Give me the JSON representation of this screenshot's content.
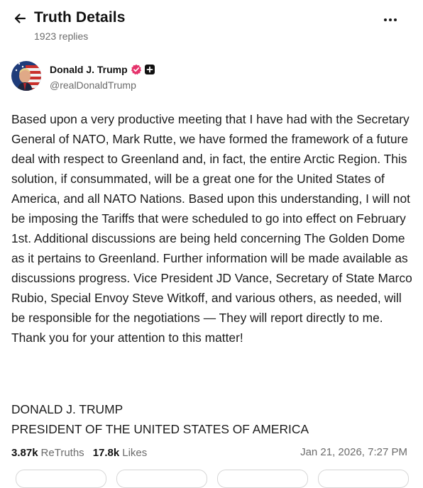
{
  "header": {
    "title": "Truth Details",
    "replies": "1923 replies"
  },
  "author": {
    "display_name": "Donald J. Trump",
    "handle": "@realDonaldTrump"
  },
  "post": {
    "body": "Based upon a very productive meeting that I have had with the Secretary General of NATO, Mark Rutte, we have formed the framework of a future deal with respect to Greenland and, in fact, the entire Arctic Region. This solution, if consummated, will be a great one for the United States of America, and all NATO Nations. Based upon this understanding, I will not be imposing the Tariffs that were scheduled to go into effect on February 1st. Additional discussions are being held concerning The Golden Dome as it pertains to Greenland. Further information will be made available as discussions progress. Vice President JD Vance, Secretary of State Marco Rubio, Special Envoy Steve Witkoff, and various others, as needed, will be responsible for the negotiations — They will report directly to me. Thank you for your attention to this matter!",
    "signature_line1": "DONALD J. TRUMP",
    "signature_line2": "PRESIDENT OF THE UNITED STATES OF AMERICA"
  },
  "stats": {
    "retruths_count": "3.87k",
    "retruths_label": "ReTruths",
    "likes_count": "17.8k",
    "likes_label": "Likes",
    "timestamp": "Jan 21, 2026, 7:27 PM"
  },
  "icons": {
    "back": "arrow-left-icon",
    "more": "ellipsis-icon",
    "verified": "verified-badge-icon",
    "plus": "plus-badge-icon"
  },
  "colors": {
    "verified_badge": "#e5336b",
    "muted_text": "#6b6b6b"
  }
}
